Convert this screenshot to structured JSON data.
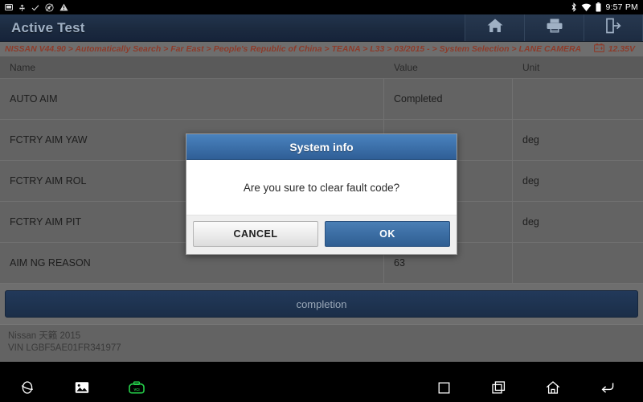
{
  "statusbar": {
    "left_icons": [
      "sd-card-icon",
      "usb-icon",
      "check-icon",
      "no-sound-icon",
      "warning-icon"
    ],
    "right_icons": [
      "bluetooth-icon",
      "wifi-icon",
      "battery-icon"
    ],
    "clock": "9:57 PM"
  },
  "titlebar": {
    "title": "Active Test",
    "actions": [
      {
        "name": "home-icon",
        "label": "Home"
      },
      {
        "name": "print-icon",
        "label": "Print"
      },
      {
        "name": "exit-icon",
        "label": "Exit"
      }
    ]
  },
  "breadcrumb": {
    "path": "NISSAN V44.90 > Automatically Search > Far East > People's Republic of China > TEANA > L33 > 03/2015 - > System Selection > LANE CAMERA",
    "voltage": "12.35V",
    "battery_icon": "battery-voltage-icon"
  },
  "table": {
    "columns": [
      "Name",
      "Value",
      "Unit"
    ],
    "rows": [
      {
        "name": "AUTO AIM",
        "value": "Completed",
        "unit": ""
      },
      {
        "name": "FCTRY AIM YAW",
        "value": "",
        "unit": "deg"
      },
      {
        "name": "FCTRY AIM ROL",
        "value": "",
        "unit": "deg"
      },
      {
        "name": "FCTRY AIM PIT",
        "value": "",
        "unit": "deg"
      },
      {
        "name": "AIM NG REASON",
        "value": "63",
        "unit": ""
      }
    ]
  },
  "completion": {
    "label": "completion"
  },
  "vehicle": {
    "model": "Nissan 天籁 2015",
    "vin": "VIN LGBF5AE01FR341977"
  },
  "dialog": {
    "title": "System info",
    "message": "Are you sure to clear fault code?",
    "cancel_label": "CANCEL",
    "ok_label": "OK"
  },
  "navbar": {
    "left": [
      "browser-icon",
      "screenshot-icon",
      "vci-connector-icon"
    ],
    "right": [
      "stop-square-icon",
      "recent-apps-icon",
      "android-home-icon",
      "back-icon"
    ]
  },
  "colors": {
    "titlebar": "#1b2a3f",
    "breadcrumb_bg": "#6e6e6e",
    "breadcrumb_text": "#8d3b2a",
    "table_bg": "#636363",
    "dialog_accent": "#3f74ae",
    "vci_green": "#25d04a"
  }
}
